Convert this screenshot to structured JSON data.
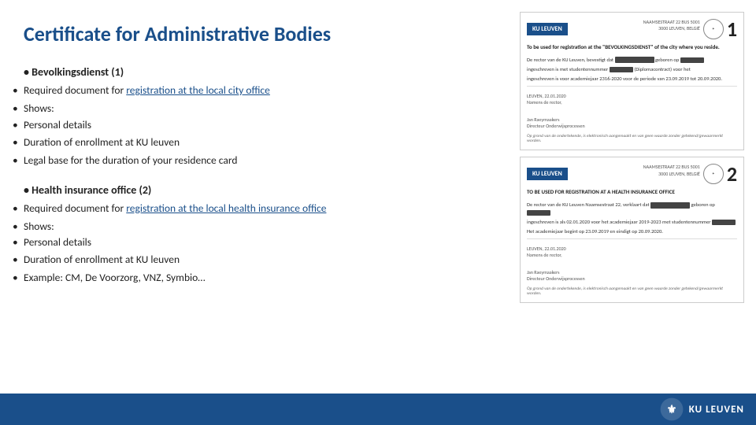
{
  "page": {
    "title": "Certificate for Administrative Bodies"
  },
  "left": {
    "sections": [
      {
        "id": "section1",
        "title": "Bevolkingsdienst (1)",
        "items": [
          {
            "text_before": "Required document for ",
            "link": "registration at the local city office",
            "text_after": ""
          },
          {
            "label": "Shows:",
            "sub_items": [
              "Personal details",
              "Duration of enrollment at KU leuven"
            ]
          },
          {
            "text_before": "Legal base for the duration of your residence card",
            "link": "",
            "text_after": ""
          }
        ]
      },
      {
        "id": "section2",
        "title": "Health insurance office (2)",
        "items": [
          {
            "text_before": "Required document for ",
            "link": "registration at the local health insurance office",
            "text_after": ""
          },
          {
            "label": "Shows:",
            "sub_items": [
              "Personal details",
              "Duration of enrollment at KU leuven"
            ]
          },
          {
            "text_before": "Example: CM, De Voorzorg, VNZ, Symbio…",
            "link": "",
            "text_after": ""
          }
        ]
      }
    ]
  },
  "right": {
    "cards": [
      {
        "number": "1",
        "badge": "KU LEUVEN",
        "title_line": "To be used for registration at the \"BEVOLKINGSDIENST\" of the city where you reside.",
        "body_line1": "De rector van de KU Leuven, bevestigt dat",
        "body_line2": "geboren op",
        "body_line3": "ingeschreven is met studentennummer",
        "body_line4": "ingeschreven is voor academiejaar 2316-2020 voor de periode van 23.09.2019 tot 20.09.2020.",
        "location": "LEUVEN, 22.01.2020",
        "namens": "Namens de rector,",
        "signer": "Jan Raeymaakers",
        "signer_title": "Directeur Onderwijsprocessen",
        "footer": "Op grond van de ondertekende, is elektronisch aangemaakt en van geen waarde zonder getekend/gewaarmerkt worden."
      },
      {
        "number": "2",
        "badge": "KU LEUVEN",
        "title_line": "TO BE USED FOR REGISTRATION AT A HEALTH INSURANCE OFFICE",
        "body_line1": "De rector van de KU Leuven Naamsestraat 22, verklaart dat",
        "body_line2": "geboren op",
        "body_line3": "ingeschreven is als 02.01.2020 voor het academiejaar 2019-2023 met studentennummer",
        "body_line4": "Het academiejaar begint op 23.09.2019 en eindigt op 20.09.2020.",
        "location": "LEUVEN, 22.01.2020",
        "namens": "Namens de rector,",
        "signer": "Jan Raeymaakers",
        "signer_title": "Directeur Onderwijsprocessen",
        "footer": "Op grond van de ondertekende, is elektronisch aangemaakt en van geen waarde zonder getekend/gewaarmerkt worden."
      }
    ]
  },
  "footer": {
    "logo_text": "KU LEUVEN"
  }
}
